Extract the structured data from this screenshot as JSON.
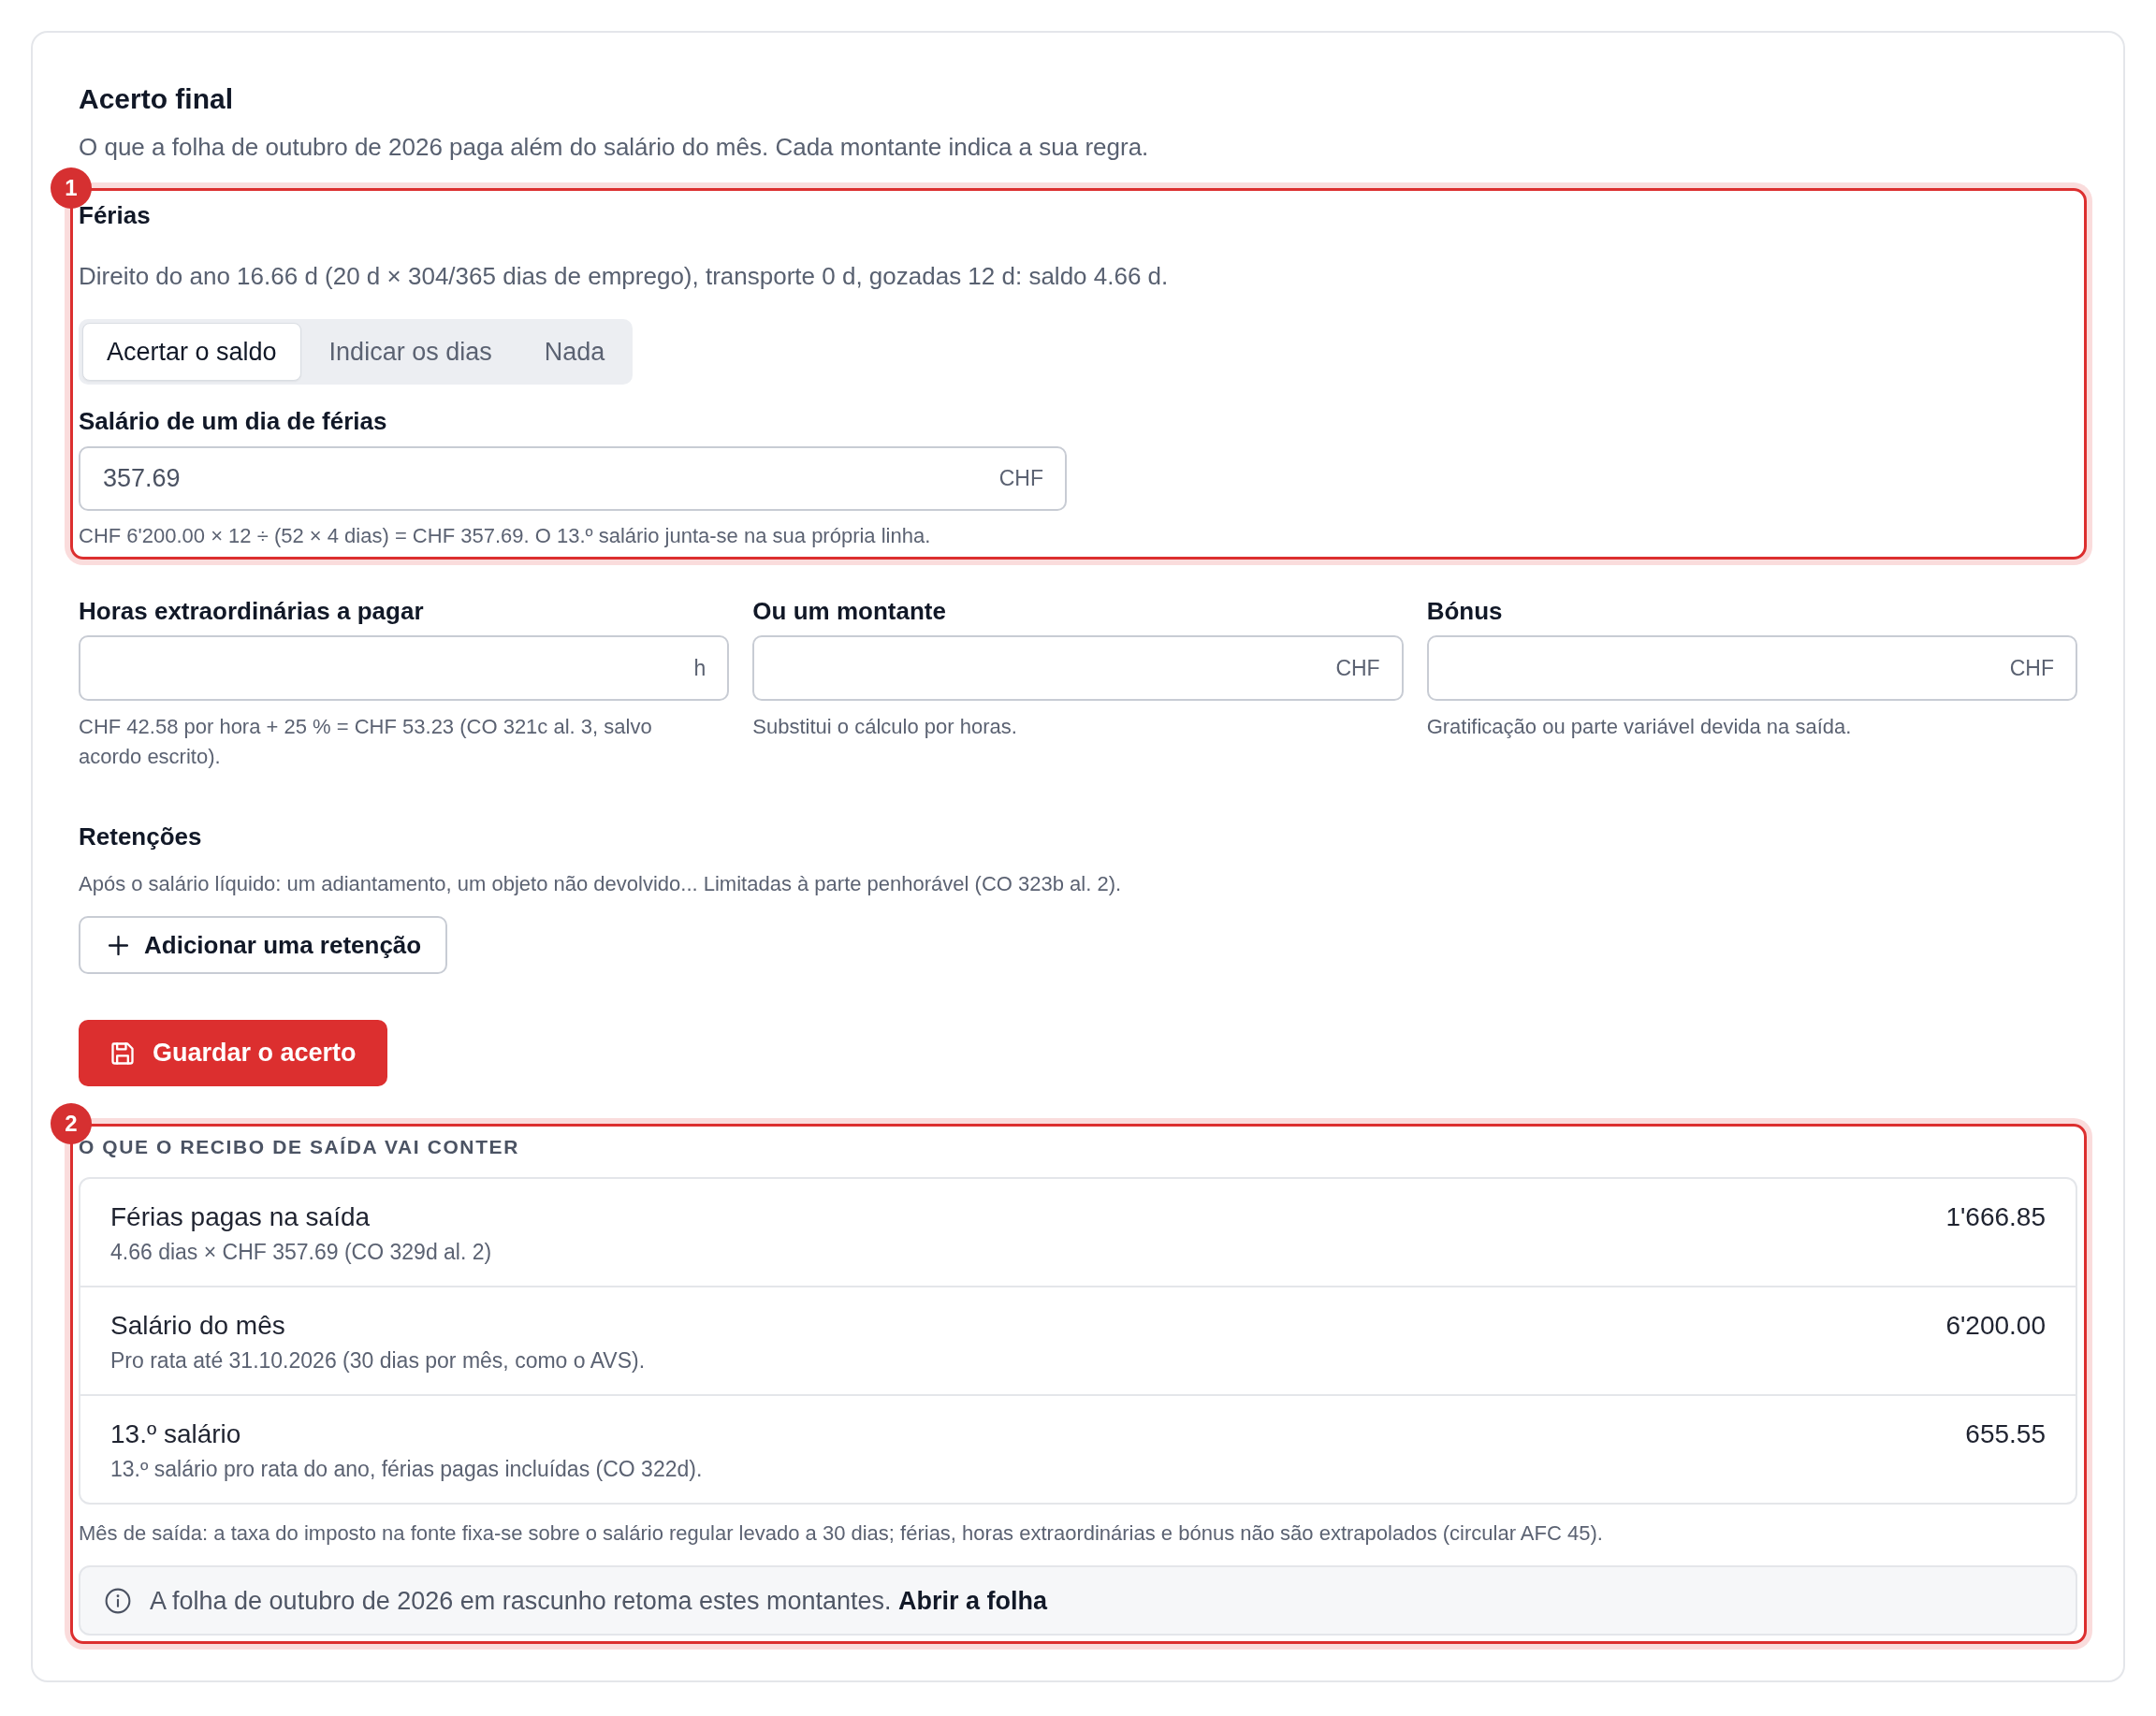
{
  "title": "Acerto final",
  "subtitle": "O que a folha de outubro de 2026 paga além do salário do mês. Cada montante indica a sua regra.",
  "vacation": {
    "badge": "1",
    "title": "Férias",
    "description": "Direito do ano 16.66 d (20 d × 304/365 dias de emprego), transporte 0 d, gozadas 12 d: saldo 4.66 d.",
    "modes": [
      {
        "label": "Acertar o saldo",
        "selected": true
      },
      {
        "label": "Indicar os dias",
        "selected": false
      },
      {
        "label": "Nada",
        "selected": false
      }
    ],
    "field": {
      "label": "Salário de um dia de férias",
      "value": "357.69",
      "unit": "CHF",
      "hint": "CHF 6'200.00 × 12 ÷ (52 × 4 dias) = CHF 357.69. O 13.º salário junta-se na sua própria linha."
    }
  },
  "fields": [
    {
      "label": "Horas extraordinárias a pagar",
      "unit": "h",
      "hint": "CHF 42.58 por hora + 25 % = CHF 53.23 (CO 321c al. 3, salvo acordo escrito)."
    },
    {
      "label": "Ou um montante",
      "unit": "CHF",
      "hint": "Substitui o cálculo por horas."
    },
    {
      "label": "Bónus",
      "unit": "CHF",
      "hint": "Gratificação ou parte variável devida na saída."
    }
  ],
  "retentions": {
    "title": "Retenções",
    "description": "Após o salário líquido: um adiantamento, um objeto não devolvido... Limitadas à parte penhorável (CO 323b al. 2).",
    "add_button": "Adicionar uma retenção"
  },
  "save_button": "Guardar o acerto",
  "receipt": {
    "badge": "2",
    "heading": "O QUE O RECIBO DE SAÍDA VAI CONTER",
    "items": [
      {
        "title": "Férias pagas na saída",
        "detail": "4.66 dias × CHF 357.69 (CO 329d al. 2)",
        "amount": "1'666.85"
      },
      {
        "title": "Salário do mês",
        "detail": "Pro rata até 31.10.2026 (30 dias por mês, como o AVS).",
        "amount": "6'200.00"
      },
      {
        "title": "13.º salário",
        "detail": "13.º salário pro rata do ano, férias pagas incluídas (CO 322d).",
        "amount": "655.55"
      }
    ],
    "note": "Mês de saída: a taxa do imposto na fonte fixa-se sobre o salário regular levado a 30 dias; férias, horas extraordinárias e bónus não são extrapolados (circular AFC 45).",
    "info": {
      "text": "A folha de outubro de 2026 em rascunho retoma estes montantes.",
      "link": "Abrir a folha"
    }
  }
}
